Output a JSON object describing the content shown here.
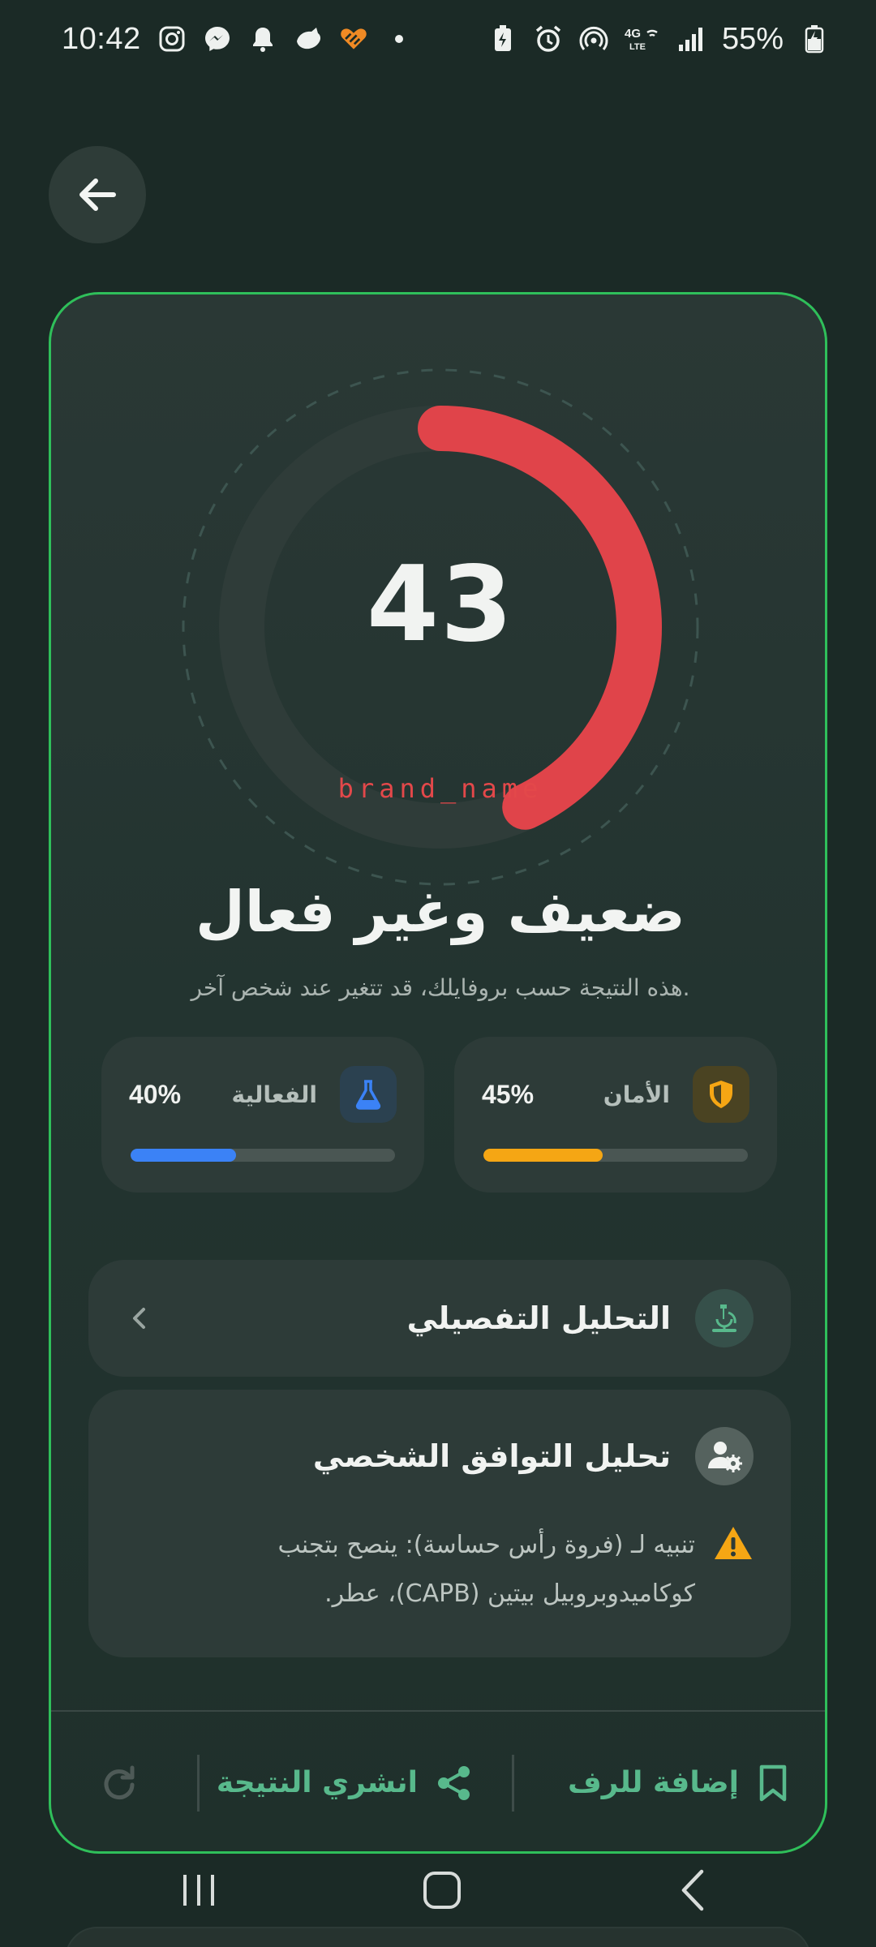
{
  "status_bar": {
    "time": "10:42",
    "battery": "55%",
    "network": "4G"
  },
  "result": {
    "score": "43",
    "score_percent": 43,
    "brand": "brand_name",
    "verdict": "ضعيف وغير فعال",
    "verdict_note": "هذه النتيجة حسب بروفايلك، قد تتغير عند شخص آخر.",
    "colors": {
      "arc": "#e0444a",
      "card_border": "#2fbf5a",
      "accent_green": "#58b98c"
    }
  },
  "metrics": {
    "safety": {
      "label": "الأمان",
      "value": "45%",
      "percent": 45,
      "color": "#f5a614",
      "icon": "shield-icon"
    },
    "efficacy": {
      "label": "الفعالية",
      "value": "40%",
      "percent": 40,
      "color": "#3b82f6",
      "icon": "flask-icon"
    }
  },
  "detailed_analysis": {
    "title": "التحليل التفصيلي",
    "icon": "microscope-icon"
  },
  "personal_compatibility": {
    "title": "تحليل التوافق الشخصي",
    "icon": "user-gear-icon",
    "warning_line1": "تنبيه لـ (فروة رأس حساسة): ينصح بتجنب",
    "warning_line2": "كوكاميدوبروبيل بيتين (CAPB)، عطر."
  },
  "actions": {
    "add_to_shelf": "إضافة للرف",
    "share_result": "انشري النتيجة"
  }
}
